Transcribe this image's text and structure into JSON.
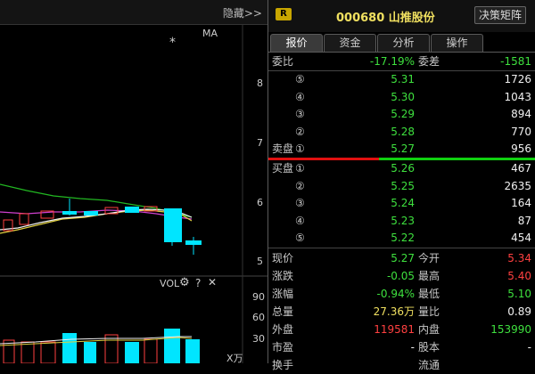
{
  "left_header": {
    "hide_label": "隐藏>>"
  },
  "kline": {
    "ma_label": "MA",
    "marker": "*",
    "price_ticks": [
      "8",
      "7",
      "6",
      "5"
    ],
    "vol_label": "VOL",
    "vol_ticks": [
      "90",
      "60",
      "30"
    ],
    "vol_unit": "X万",
    "question_mark": "?",
    "close_glyph": "✕"
  },
  "stock": {
    "badge": "R",
    "title": "000680 山推股份",
    "decision_button": "决策矩阵"
  },
  "tabs": [
    {
      "label": "报价",
      "active": true
    },
    {
      "label": "资金",
      "active": false
    },
    {
      "label": "分析",
      "active": false
    },
    {
      "label": "操作",
      "active": false
    }
  ],
  "ratio": {
    "label1": "委比",
    "value1": "-17.19%",
    "label2": "委差",
    "value2": "-1581"
  },
  "asks": [
    {
      "label": "",
      "level": "⑤",
      "price": "5.31",
      "volume": "1726"
    },
    {
      "label": "",
      "level": "④",
      "price": "5.30",
      "volume": "1043"
    },
    {
      "label": "",
      "level": "③",
      "price": "5.29",
      "volume": "894"
    },
    {
      "label": "",
      "level": "②",
      "price": "5.28",
      "volume": "770"
    },
    {
      "label": "卖盘",
      "level": "①",
      "price": "5.27",
      "volume": "956"
    }
  ],
  "bids": [
    {
      "label": "买盘",
      "level": "①",
      "price": "5.26",
      "volume": "467"
    },
    {
      "label": "",
      "level": "②",
      "price": "5.25",
      "volume": "2635"
    },
    {
      "label": "",
      "level": "③",
      "price": "5.24",
      "volume": "164"
    },
    {
      "label": "",
      "level": "④",
      "price": "5.23",
      "volume": "87"
    },
    {
      "label": "",
      "level": "⑤",
      "price": "5.22",
      "volume": "454"
    }
  ],
  "stats": [
    {
      "l1": "现价",
      "v1": "5.27",
      "c1": "green",
      "l2": "今开",
      "v2": "5.34",
      "c2": "red"
    },
    {
      "l1": "涨跌",
      "v1": "-0.05",
      "c1": "green",
      "l2": "最高",
      "v2": "5.40",
      "c2": "red"
    },
    {
      "l1": "涨幅",
      "v1": "-0.94%",
      "c1": "green",
      "l2": "最低",
      "v2": "5.10",
      "c2": "green"
    },
    {
      "l1": "总量",
      "v1": "27.36万",
      "c1": "yellow",
      "l2": "量比",
      "v2": "0.89",
      "c2": "white"
    },
    {
      "l1": "外盘",
      "v1": "119581",
      "c1": "red",
      "l2": "内盘",
      "v2": "153990",
      "c2": "green"
    },
    {
      "l1": "市盈",
      "v1": "-",
      "c1": "white",
      "l2": "股本",
      "v2": "-",
      "c2": "white"
    },
    {
      "l1": "换手",
      "v1": "",
      "c1": "white",
      "l2": "流通",
      "v2": "",
      "c2": "white"
    }
  ],
  "colors": {
    "up": "#ff4040",
    "down": "#3ee03e",
    "volume_up": "#00e5ff",
    "accent": "#f0e060"
  }
}
